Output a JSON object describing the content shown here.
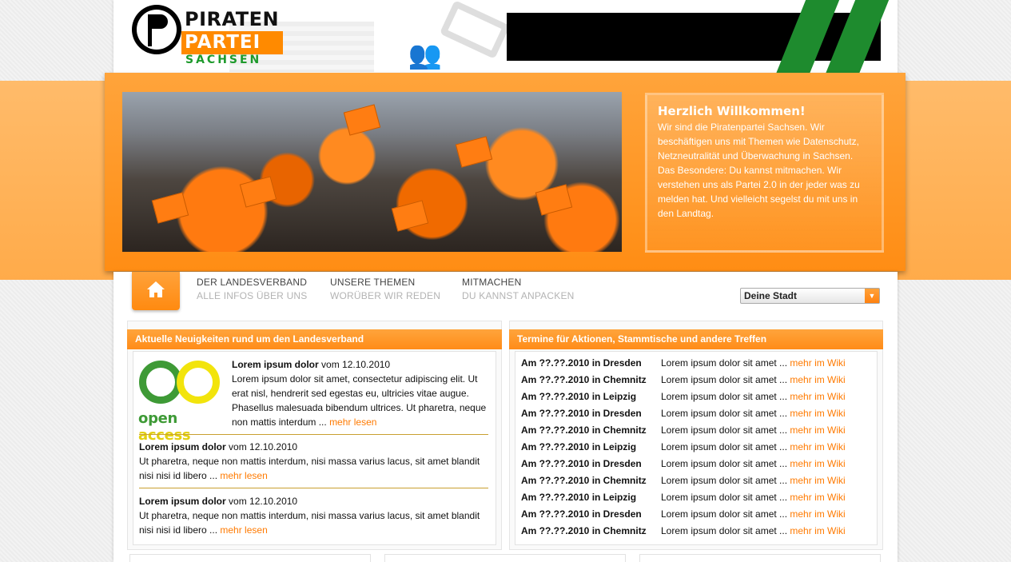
{
  "logo": {
    "line1": "PIRATEN",
    "line2": "PARTEI",
    "line3": "SACHSEN"
  },
  "welcome": {
    "title": "Herzlich Willkommen!",
    "text": "Wir sind die Piratenpartei Sachsen. Wir beschäftigen uns mit Themen wie Datenschutz, Netzneutralität und Überwachung in Sachsen. Das Besondere: Du kannst mitmachen. Wir verstehen uns als Partei 2.0 in der jeder was zu melden hat. Und vielleicht segelst du mit uns in den Landtag."
  },
  "nav": {
    "home_icon": "home-icon",
    "items": [
      {
        "title": "DER LANDESVERBAND",
        "subtitle": "ALLE INFOS ÜBER UNS"
      },
      {
        "title": "UNSERE THEMEN",
        "subtitle": "WORÜBER WIR REDEN"
      },
      {
        "title": "MITMACHEN",
        "subtitle": "DU KANNST ANPACKEN"
      }
    ],
    "city_select": "Deine Stadt"
  },
  "news": {
    "heading": "Aktuelle Neuigkeiten rund um den Landesverband",
    "logo_text1": "open ",
    "logo_text2": "access",
    "items": [
      {
        "title": "Lorem ipsum dolor",
        "date": " vom 12.10.2010",
        "text": "Lorem ipsum dolor sit amet, consectetur adipiscing elit. Ut erat nisl, hendrerit sed egestas eu, ultricies vitae augue. Phasellus malesuada bibendum ultrices. Ut pharetra, neque non mattis interdum ... ",
        "more": "mehr lesen"
      },
      {
        "title": "Lorem ipsum dolor",
        "date": " vom 12.10.2010",
        "text": "Ut pharetra, neque non mattis interdum, nisi massa varius lacus, sit amet blandit nisi nisi id libero ... ",
        "more": "mehr lesen"
      },
      {
        "title": "Lorem ipsum dolor",
        "date": " vom 12.10.2010",
        "text": "Ut pharetra, neque non mattis interdum, nisi massa varius lacus, sit amet blandit nisi nisi id libero ... ",
        "more": "mehr lesen"
      }
    ]
  },
  "events": {
    "heading": "Termine für Aktionen, Stammtische und andere Treffen",
    "rows": [
      {
        "date": "Am ??.??.2010 in Dresden",
        "text": "Lorem ipsum dolor sit amet ... ",
        "more": "mehr im Wiki"
      },
      {
        "date": "Am ??.??.2010 in Chemnitz",
        "text": "Lorem ipsum dolor sit amet ... ",
        "more": "mehr im Wiki"
      },
      {
        "date": "Am ??.??.2010 in Leipzig",
        "text": "Lorem ipsum dolor sit amet ... ",
        "more": "mehr im Wiki"
      },
      {
        "date": "Am ??.??.2010 in Dresden",
        "text": "Lorem ipsum dolor sit amet ... ",
        "more": "mehr im Wiki"
      },
      {
        "date": "Am ??.??.2010 in Chemnitz",
        "text": "Lorem ipsum dolor sit amet ... ",
        "more": "mehr im Wiki"
      },
      {
        "date": "Am ??.??.2010 in Leipzig",
        "text": "Lorem ipsum dolor sit amet ... ",
        "more": "mehr im Wiki"
      },
      {
        "date": "Am ??.??.2010 in Dresden",
        "text": "Lorem ipsum dolor sit amet ... ",
        "more": "mehr im Wiki"
      },
      {
        "date": "Am ??.??.2010 in Chemnitz",
        "text": "Lorem ipsum dolor sit amet ... ",
        "more": "mehr im Wiki"
      },
      {
        "date": "Am ??.??.2010 in Leipzig",
        "text": "Lorem ipsum dolor sit amet ... ",
        "more": "mehr im Wiki"
      },
      {
        "date": "Am ??.??.2010 in Dresden",
        "text": "Lorem ipsum dolor sit amet ... ",
        "more": "mehr im Wiki"
      },
      {
        "date": "Am ??.??.2010 in Chemnitz",
        "text": "Lorem ipsum dolor sit amet ... ",
        "more": "mehr im Wiki"
      }
    ]
  },
  "colors": {
    "brand_orange": "#ff8a00",
    "brand_green": "#1e8b2e",
    "link_orange": "#ff7a00"
  }
}
